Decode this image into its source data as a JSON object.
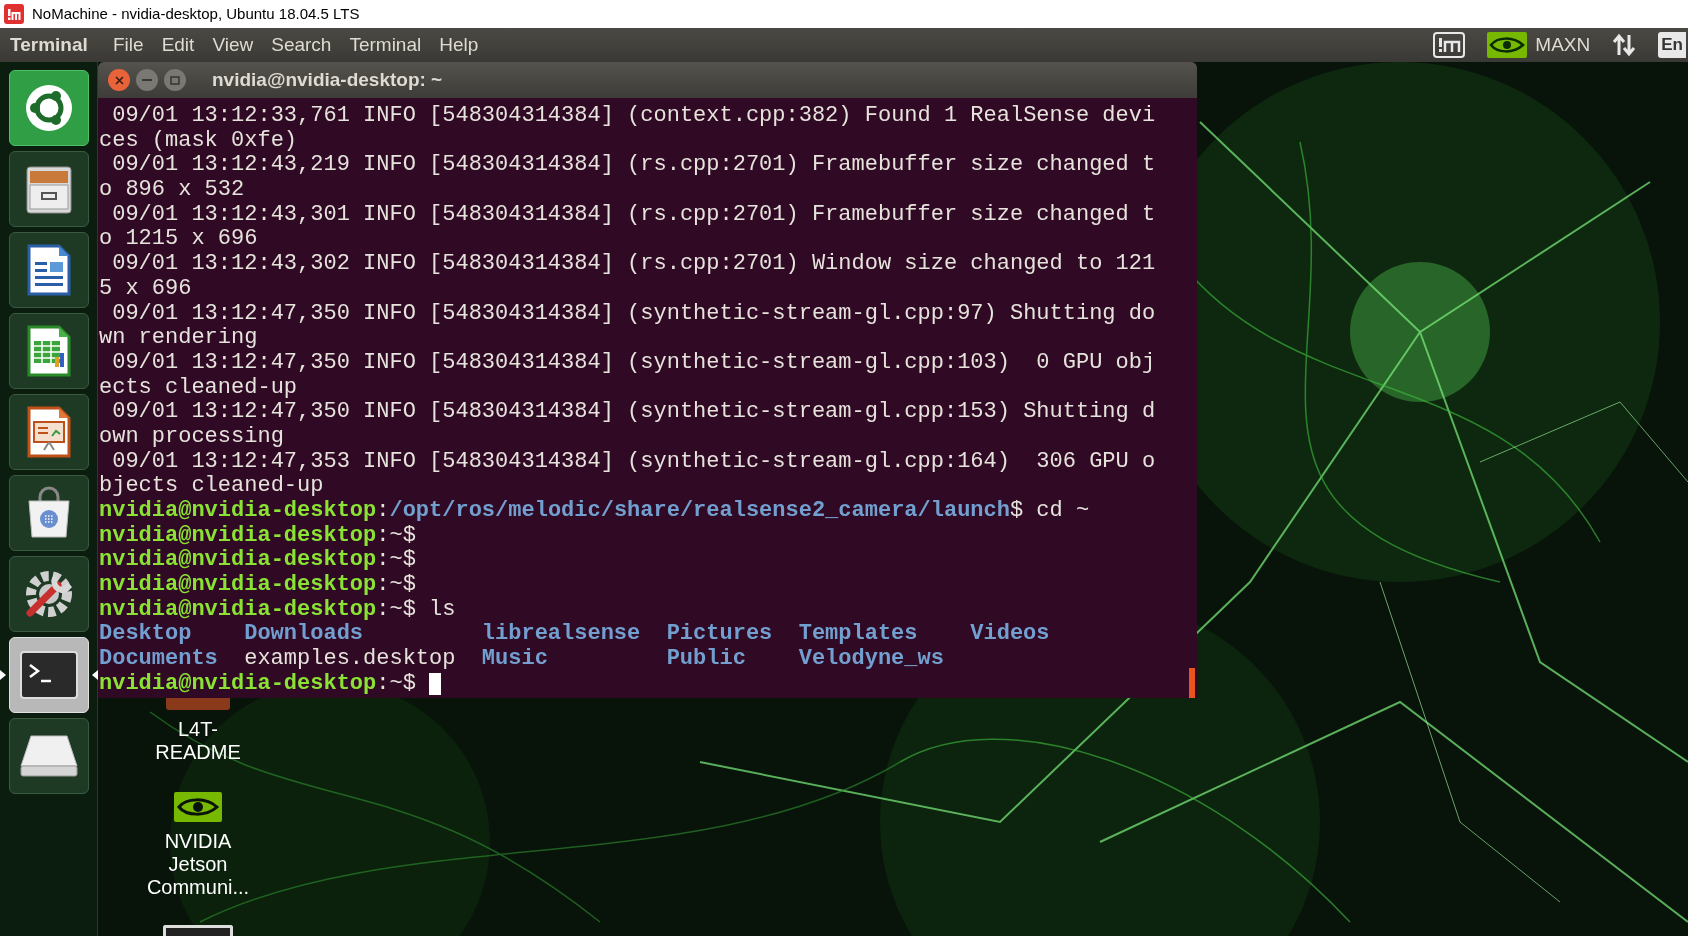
{
  "app_window": {
    "title": "NoMachine - nvidia-desktop, Ubuntu 18.04.5 LTS"
  },
  "top_panel": {
    "app_name": "Terminal",
    "menus": [
      "File",
      "Edit",
      "View",
      "Search",
      "Terminal",
      "Help"
    ],
    "indicators": [
      {
        "kind": "nomachine"
      },
      {
        "kind": "nvidia",
        "label": "MAXN"
      },
      {
        "kind": "network"
      },
      {
        "kind": "keyboard",
        "label": "En"
      }
    ]
  },
  "launcher": {
    "items": [
      {
        "kind": "dash",
        "active": false
      },
      {
        "kind": "files",
        "active": false
      },
      {
        "kind": "writer",
        "active": false
      },
      {
        "kind": "calc",
        "active": false
      },
      {
        "kind": "impress",
        "active": false
      },
      {
        "kind": "software",
        "active": false
      },
      {
        "kind": "settings",
        "active": false
      },
      {
        "kind": "terminal",
        "active": true
      },
      {
        "kind": "drive",
        "active": false
      }
    ]
  },
  "terminal": {
    "title": "nvidia@nvidia-desktop: ~",
    "lines": [
      {
        "kind": "log",
        "text": " 09/01 13:12:33,761 INFO [548304314384] (context.cpp:382) Found 1 RealSense devi"
      },
      {
        "kind": "log",
        "text": "ces (mask 0xfe)"
      },
      {
        "kind": "log",
        "text": " 09/01 13:12:43,219 INFO [548304314384] (rs.cpp:2701) Framebuffer size changed t"
      },
      {
        "kind": "log",
        "text": "o 896 x 532"
      },
      {
        "kind": "log",
        "text": " 09/01 13:12:43,301 INFO [548304314384] (rs.cpp:2701) Framebuffer size changed t"
      },
      {
        "kind": "log",
        "text": "o 1215 x 696"
      },
      {
        "kind": "log",
        "text": " 09/01 13:12:43,302 INFO [548304314384] (rs.cpp:2701) Window size changed to 121"
      },
      {
        "kind": "log",
        "text": "5 x 696"
      },
      {
        "kind": "log",
        "text": " 09/01 13:12:47,350 INFO [548304314384] (synthetic-stream-gl.cpp:97) Shutting do"
      },
      {
        "kind": "log",
        "text": "wn rendering"
      },
      {
        "kind": "log",
        "text": " 09/01 13:12:47,350 INFO [548304314384] (synthetic-stream-gl.cpp:103)  0 GPU obj"
      },
      {
        "kind": "log",
        "text": "ects cleaned-up"
      },
      {
        "kind": "log",
        "text": " 09/01 13:12:47,350 INFO [548304314384] (synthetic-stream-gl.cpp:153) Shutting d"
      },
      {
        "kind": "log",
        "text": "own processing"
      },
      {
        "kind": "log",
        "text": " 09/01 13:12:47,353 INFO [548304314384] (synthetic-stream-gl.cpp:164)  306 GPU o"
      },
      {
        "kind": "log",
        "text": "bjects cleaned-up"
      },
      {
        "kind": "prompt",
        "user": "nvidia@nvidia-desktop",
        "colon": ":",
        "path": "/opt/ros/melodic/share/realsense2_camera/launch",
        "suffix": "$ cd ~"
      },
      {
        "kind": "prompt",
        "user": "nvidia@nvidia-desktop",
        "suffix": ":~$"
      },
      {
        "kind": "prompt",
        "user": "nvidia@nvidia-desktop",
        "suffix": ":~$"
      },
      {
        "kind": "prompt",
        "user": "nvidia@nvidia-desktop",
        "suffix": ":~$"
      },
      {
        "kind": "prompt",
        "user": "nvidia@nvidia-desktop",
        "suffix": ":~$ ls"
      },
      {
        "kind": "ls",
        "entries": [
          {
            "name": "Desktop",
            "kind": "directory"
          },
          {
            "name": "Downloads",
            "kind": "directory"
          },
          {
            "name": "librealsense",
            "kind": "directory"
          },
          {
            "name": "Pictures",
            "kind": "directory"
          },
          {
            "name": "Templates",
            "kind": "directory"
          },
          {
            "name": "Videos",
            "kind": "directory"
          }
        ]
      },
      {
        "kind": "ls",
        "entries": [
          {
            "name": "Documents",
            "kind": "directory"
          },
          {
            "name": "examples.desktop",
            "kind": "file"
          },
          {
            "name": "Music",
            "kind": "directory"
          },
          {
            "name": "Public",
            "kind": "directory"
          },
          {
            "name": "Velodyne_ws",
            "kind": "directory"
          }
        ]
      },
      {
        "kind": "prompt",
        "cursor": true,
        "user": "nvidia@nvidia-desktop",
        "suffix": ":~$"
      }
    ]
  },
  "desktop_icons": [
    {
      "kind": "document",
      "label": "L4T-README"
    },
    {
      "kind": "nvidia",
      "label": "NVIDIA Jetson Communi..."
    },
    {
      "kind": "monitor"
    }
  ]
}
